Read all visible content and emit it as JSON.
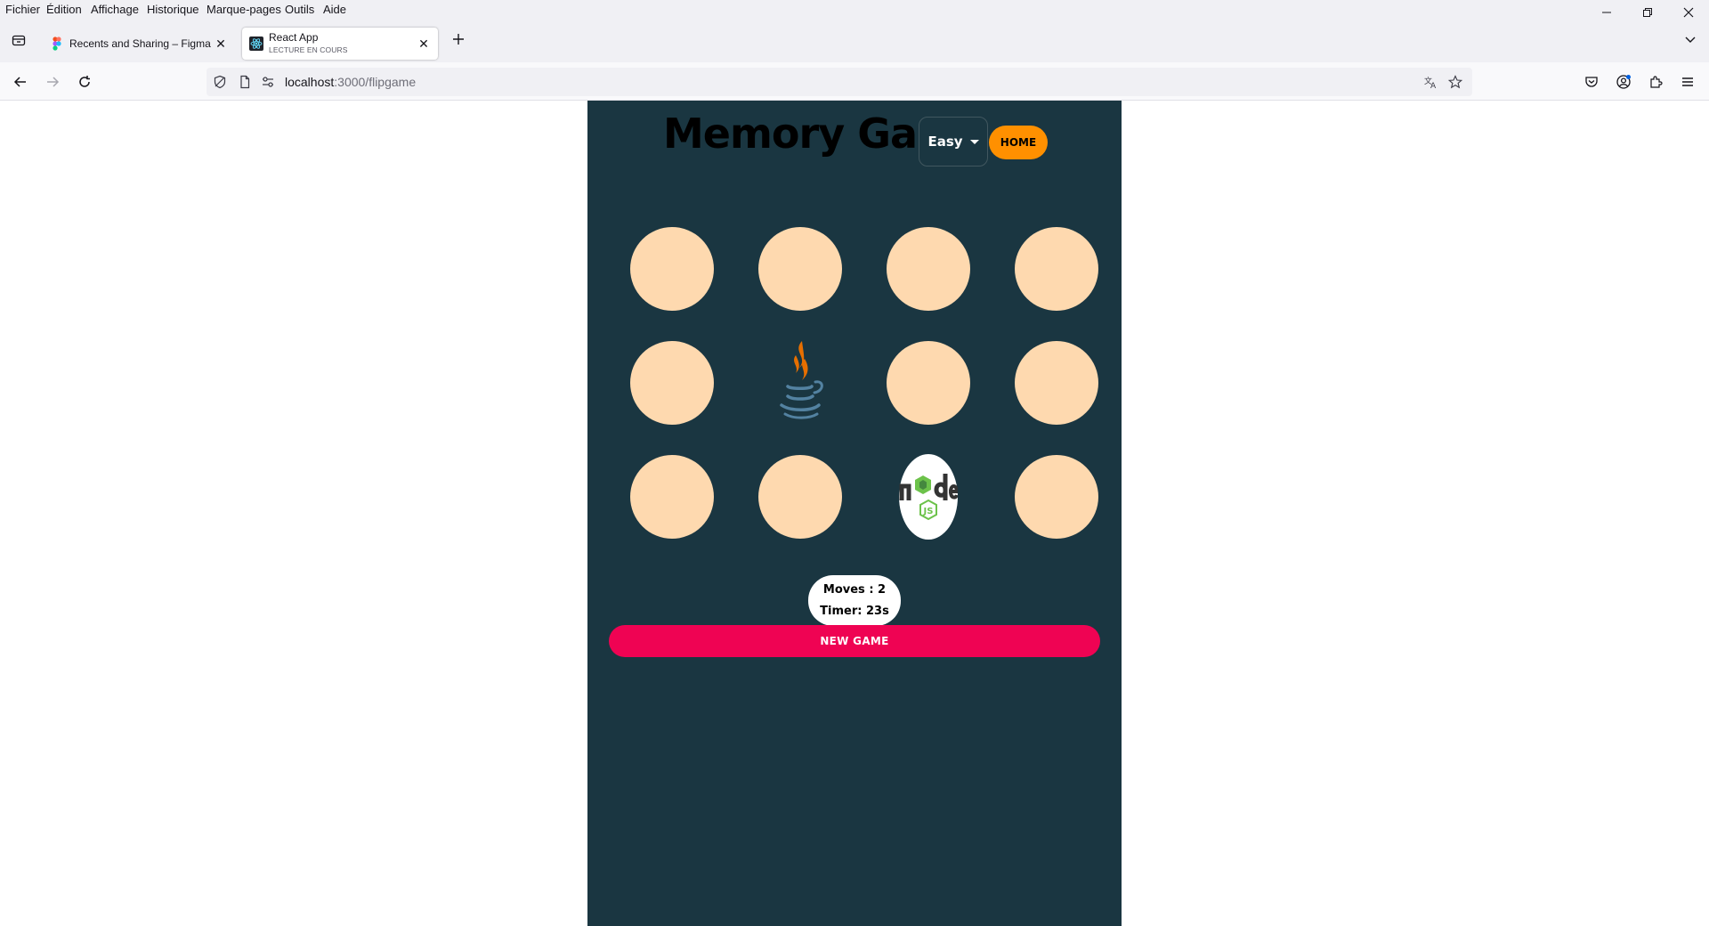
{
  "menubar": {
    "items": [
      "Fichier",
      "Édition",
      "Affichage",
      "Historique",
      "Marque-pages",
      "Outils",
      "Aide"
    ]
  },
  "tabs": [
    {
      "title": "Recents and Sharing – Figma",
      "subtitle": "",
      "active": false,
      "favicon": "figma-icon"
    },
    {
      "title": "React App",
      "subtitle": "LECTURE EN COURS",
      "active": true,
      "favicon": "react-icon"
    }
  ],
  "urlbar": {
    "host": "localhost",
    "path": ":3000/flipgame"
  },
  "app": {
    "title": "Memory Game",
    "difficulty": "Easy",
    "home_label": "HOME",
    "new_game_label": "NEW GAME",
    "moves": "Moves : 2",
    "timer": "Timer: 23s",
    "colors": {
      "background": "#1a3641",
      "card_back": "#fed9af",
      "home": "#ff9000",
      "new_game": "#ef0353"
    }
  },
  "board": {
    "rows": 3,
    "cols": 4,
    "cards": [
      {
        "state": "hidden"
      },
      {
        "state": "hidden"
      },
      {
        "state": "hidden"
      },
      {
        "state": "hidden"
      },
      {
        "state": "hidden"
      },
      {
        "state": "revealed",
        "icon": "java-icon"
      },
      {
        "state": "hidden"
      },
      {
        "state": "hidden"
      },
      {
        "state": "hidden"
      },
      {
        "state": "hidden"
      },
      {
        "state": "revealed",
        "icon": "nodejs-icon"
      },
      {
        "state": "hidden"
      }
    ]
  }
}
